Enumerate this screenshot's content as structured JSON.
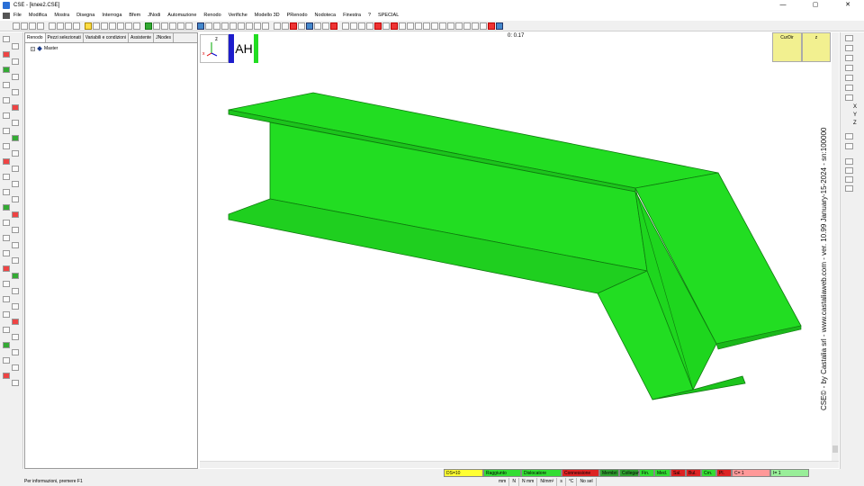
{
  "window": {
    "title": "CSE - [knee2.CSE]"
  },
  "window_controls": {
    "minimize": "—",
    "restore": "▢",
    "close": "✕"
  },
  "menu": [
    "File",
    "Modifica",
    "Mostra",
    "Disegna",
    "Interroga",
    "Bfem",
    "JNodi",
    "Automazione",
    "Renodo",
    "Verifiche",
    "Modello 3D",
    "PRenodo",
    "Nodoteca",
    "Finestra",
    "?",
    "SPECIAL"
  ],
  "panel": {
    "tabs": [
      "Renodo",
      "Pezzi selezionati",
      "Variabili e condizioni",
      "Assistente",
      "JNodes"
    ],
    "tree": {
      "expander": "+",
      "label": "Master"
    }
  },
  "viewport": {
    "coords": "0: 0.17",
    "ah_label": "AH",
    "axis_label": "z",
    "axis_sub": "x",
    "curdir_label": "CurDir",
    "z_label": "z",
    "beam_color": "#22dd22",
    "beam_edge": "#0f7a0f",
    "credit": "CSE© - by Castalia srl - www.castaliaweb.com - ver. 10.99 January-15-2024 - sn:100000"
  },
  "right_axes": [
    "X",
    "Y",
    "Z"
  ],
  "status": {
    "info": "Per informazioni, premere F1",
    "cells": [
      {
        "label": "DS=10",
        "color": "#ffff33",
        "w": 44
      },
      {
        "label": "Raggiunto",
        "color": "#33dd33",
        "w": 42
      },
      {
        "label": "Dislocatore",
        "color": "#33dd33",
        "w": 45
      },
      {
        "label": "Connessione",
        "color": "#dd2222",
        "w": 42
      },
      {
        "label": "Membri",
        "color": "#2fa02f",
        "w": 22
      },
      {
        "label": "Collegamenti",
        "color": "#2fa02f",
        "w": 22
      },
      {
        "label": "Fin.",
        "color": "#33dd33",
        "w": 17
      },
      {
        "label": "Med.",
        "color": "#33dd33",
        "w": 18
      },
      {
        "label": "Sal.",
        "color": "#dd2222",
        "w": 17
      },
      {
        "label": "Bul.",
        "color": "#dd2222",
        "w": 17
      },
      {
        "label": "Crn.",
        "color": "#33dd33",
        "w": 17
      },
      {
        "label": "Pl.",
        "color": "#dd2222",
        "w": 17
      },
      {
        "label": "C= 1",
        "color": "#ff9999",
        "w": 43
      },
      {
        "label": "I= 1",
        "color": "#99ee99",
        "w": 43
      }
    ],
    "units": [
      "mm",
      "N",
      "N mm",
      "N/mm²",
      "s",
      "°C",
      "No sel"
    ]
  }
}
